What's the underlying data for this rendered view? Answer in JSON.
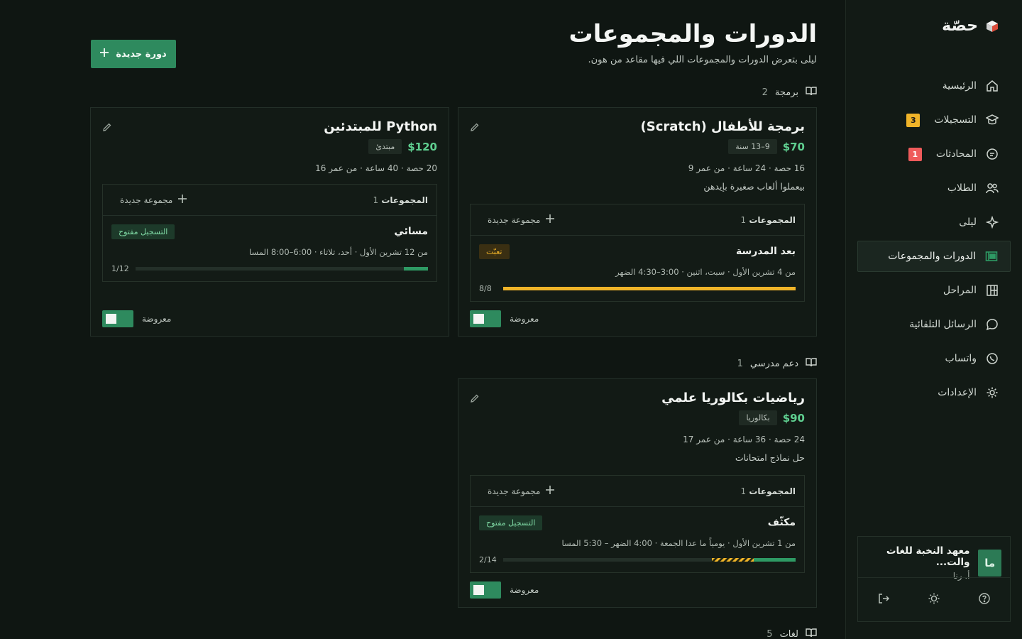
{
  "brand": {
    "name": "حصّة",
    "icon": "cube-icon"
  },
  "nav": [
    {
      "label": "الرئيسية",
      "icon": "home-icon",
      "badge": null
    },
    {
      "label": "التسجيلات",
      "icon": "graduation-cap-icon",
      "badge": "3",
      "badge_color": "#f0b429"
    },
    {
      "label": "المحادثات",
      "icon": "chat-icon",
      "badge": "1",
      "badge_color": "#ef5b5b"
    },
    {
      "label": "الطلاب",
      "icon": "users-icon",
      "badge": null
    },
    {
      "label": "ليلى",
      "icon": "sparkle-icon",
      "badge": null
    },
    {
      "label": "الدورات والمجموعات",
      "icon": "layout-icon",
      "badge": null,
      "active": true
    },
    {
      "label": "المراحل",
      "icon": "kanban-icon",
      "badge": null
    },
    {
      "label": "الرسائل التلقائية",
      "icon": "message-icon",
      "badge": null
    },
    {
      "label": "واتساب",
      "icon": "whatsapp-icon",
      "badge": null
    },
    {
      "label": "الإعدادات",
      "icon": "gear-icon",
      "badge": null
    }
  ],
  "org": {
    "avatar": "ما",
    "name": "معهد النخبة للغات والت...",
    "user": "أ. رنا"
  },
  "page": {
    "title": "الدورات والمجموعات",
    "subtitle": "ليلى بتعرض الدورات والمجموعات اللي فيها مقاعد من هون.",
    "new_course": "دورة جديدة"
  },
  "sections": [
    {
      "name": "برمجة",
      "count": "2",
      "courses": [
        {
          "title": "برمجة للأطفال (Scratch)",
          "price": "$70",
          "tag": "9–13 سنة",
          "meta": "16 حصة · 24 ساعة · من عمر 9",
          "desc": "بيعملوا ألعاب صغيرة بإيدهن",
          "groups_label": "المجموعات",
          "groups_count": "1",
          "add_group": "مجموعة جديدة",
          "group": {
            "name": "بعد المدرسة",
            "schedule": "من 4 تشرين الأول · سبت، اثنين · 3:00–4:30 الضهر",
            "status": "تعبّت",
            "status_type": "full",
            "enrolled": "8/8",
            "fill": 1.0
          },
          "visible_label": "معروضة"
        },
        {
          "title": "Python للمبتدئين",
          "price": "$120",
          "tag": "مبتدئ",
          "meta": "20 حصة · 40 ساعة · من عمر 16",
          "desc": "",
          "groups_label": "المجموعات",
          "groups_count": "1",
          "add_group": "مجموعة جديدة",
          "group": {
            "name": "مسائي",
            "schedule": "من 12 تشرين الأول · أحد، تلاتاء · 6:00–8:00 المسا",
            "status": "التسجيل مفتوح",
            "status_type": "open",
            "enrolled": "1/12",
            "fill": 0.083
          },
          "visible_label": "معروضة"
        }
      ]
    },
    {
      "name": "دعم مدرسي",
      "count": "1",
      "courses": [
        {
          "title": "رياضيات بكالوريا علمي",
          "price": "$90",
          "tag": "بكالوريا",
          "meta": "24 حصة · 36 ساعة · من عمر 17",
          "desc": "حل نماذج امتحانات",
          "groups_label": "المجموعات",
          "groups_count": "1",
          "add_group": "مجموعة جديدة",
          "group": {
            "name": "مكثّف",
            "schedule": "من 1 تشرين الأول · يومياً ما عدا الجمعة · 4:00 الضهر – 5:30 المسا",
            "status": "التسجيل مفتوح",
            "status_type": "open",
            "enrolled": "2/14",
            "fill": 0.143,
            "pending_fill": 0.143
          },
          "visible_label": "معروضة"
        }
      ]
    },
    {
      "name": "لغات",
      "count": "5",
      "courses": []
    }
  ],
  "colors": {
    "accent": "#2e8a5e",
    "price": "#5fcf90",
    "warning": "#f0b429",
    "danger": "#ef5b5b"
  }
}
